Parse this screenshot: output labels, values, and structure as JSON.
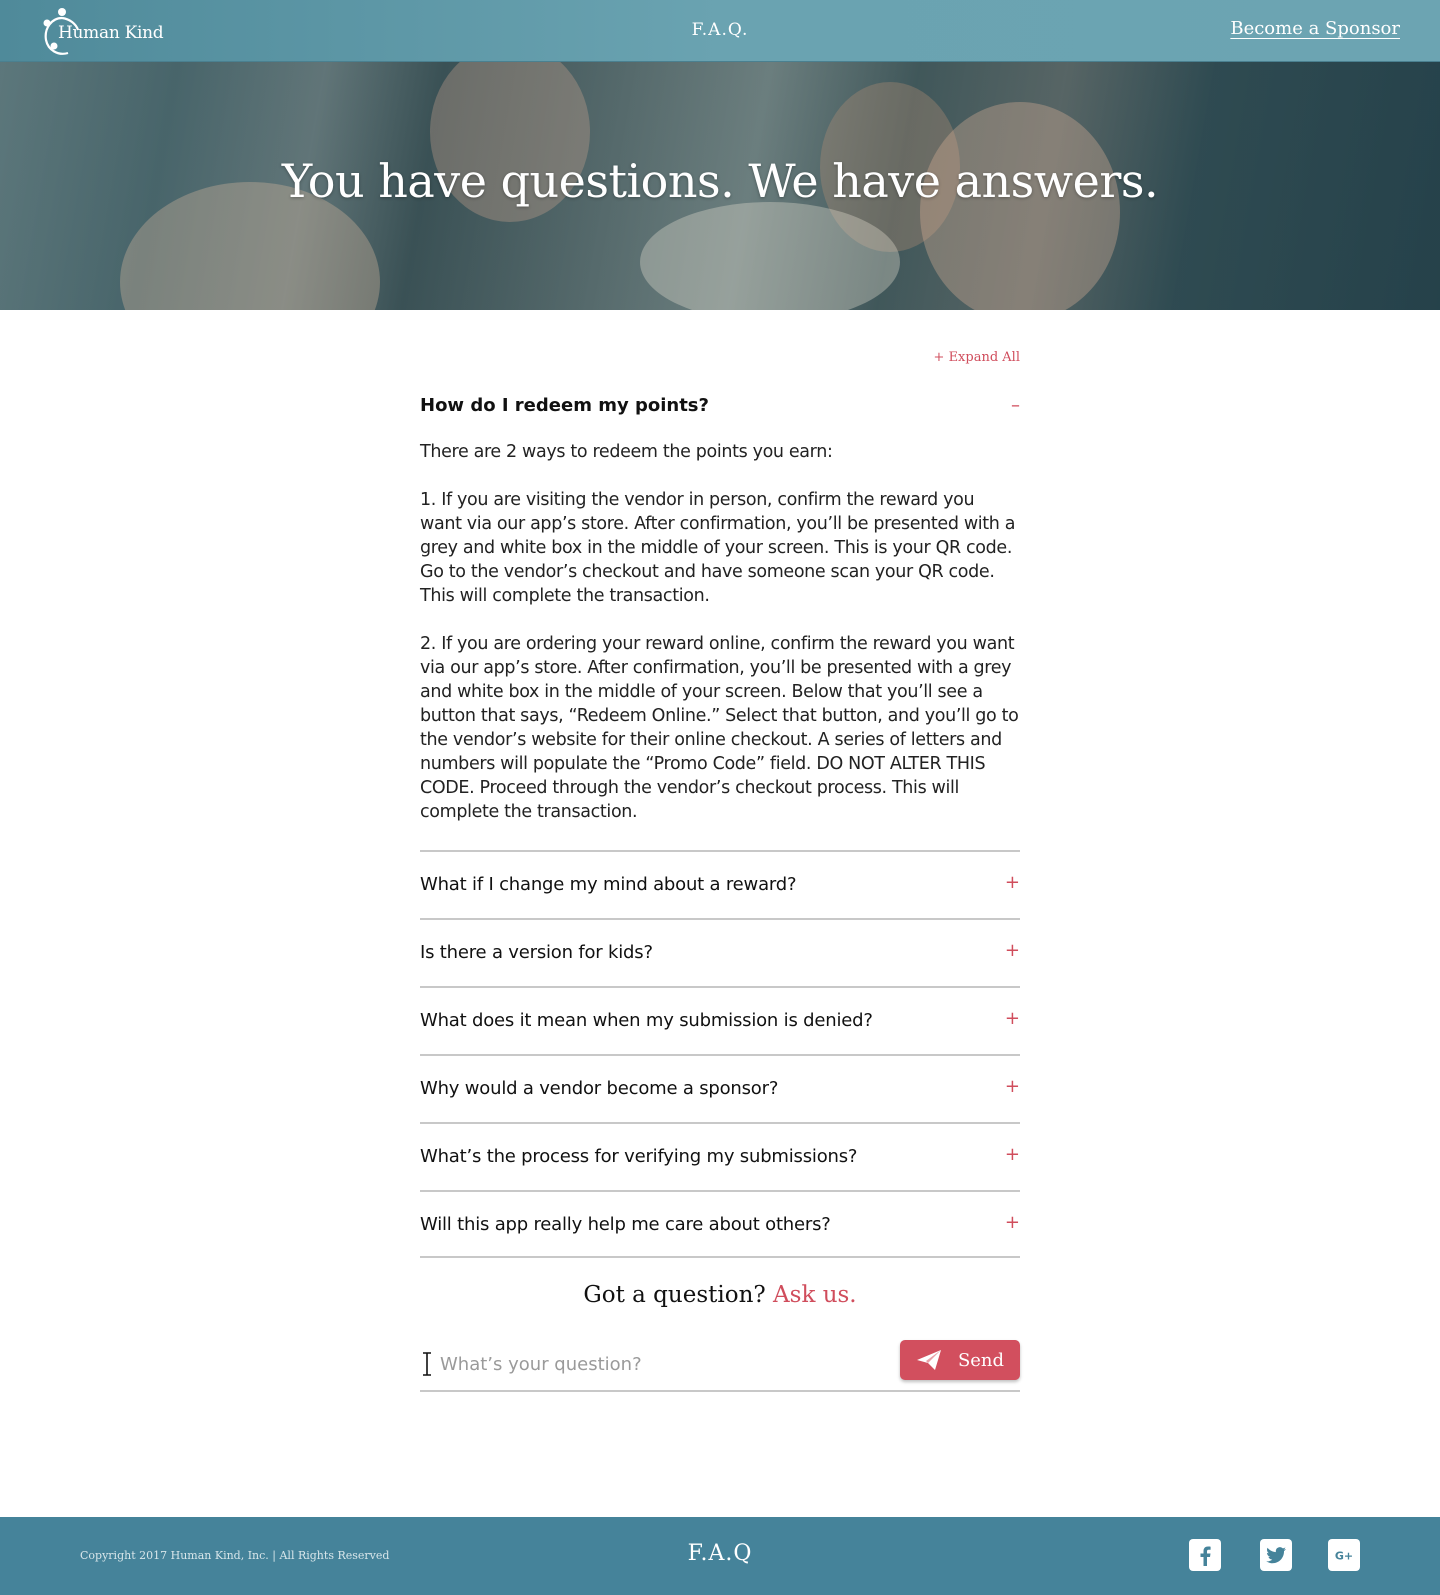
{
  "header": {
    "logo_text": "Human Kind",
    "nav_label": "F.A.Q.",
    "sponsor_link": "Become a Sponsor"
  },
  "hero": {
    "title": "You have questions. We have answers."
  },
  "faq": {
    "expand_all": "+ Expand All",
    "open_item": {
      "question": "How do I redeem my points?",
      "toggle": "–",
      "answer_paragraphs": [
        "There are 2 ways to redeem the points you earn:",
        "1. If you are visiting the vendor in person, confirm the reward you want via our app’s store. After confirmation, you’ll be presented with a grey and white box in the middle of your screen. This is your QR code. Go to the vendor’s checkout and have someone scan your QR code. This will complete the transaction.",
        "2. If you are ordering your reward online, confirm the reward you want via our app’s store. After confirmation, you’ll be presented with a grey and white box in the middle of your screen. Below that you’ll see a button that says, “Redeem Online.” Select that button, and you’ll go to the vendor’s website for their online checkout. A series of letters and numbers will populate the “Promo Code” field. DO NOT ALTER THIS CODE. Proceed through the vendor’s checkout process. This will complete the transaction."
      ]
    },
    "toggle_closed": "+",
    "items": [
      {
        "question": "What if I change my mind about a reward?"
      },
      {
        "question": "Is there a version for kids?"
      },
      {
        "question": "What does it mean when my submission is denied?"
      },
      {
        "question": "Why would a vendor become a sponsor?"
      },
      {
        "question": "What’s the process for verifying my submissions?"
      },
      {
        "question": "Will this app really help me care about others?"
      }
    ]
  },
  "ask": {
    "heading": "Got a question?",
    "heading_accent": "Ask us.",
    "placeholder": "What’s your question?",
    "send_label": "Send"
  },
  "footer": {
    "copyright": "Copyright 2017 Human Kind, Inc. | All Rights Reserved",
    "faq_label": "F.A.Q",
    "social": [
      "facebook-icon",
      "twitter-icon",
      "google-plus-icon"
    ]
  },
  "colors": {
    "header_bg": "#5f98a7",
    "accent": "#d04d5c",
    "footer_bg": "#45839a"
  }
}
